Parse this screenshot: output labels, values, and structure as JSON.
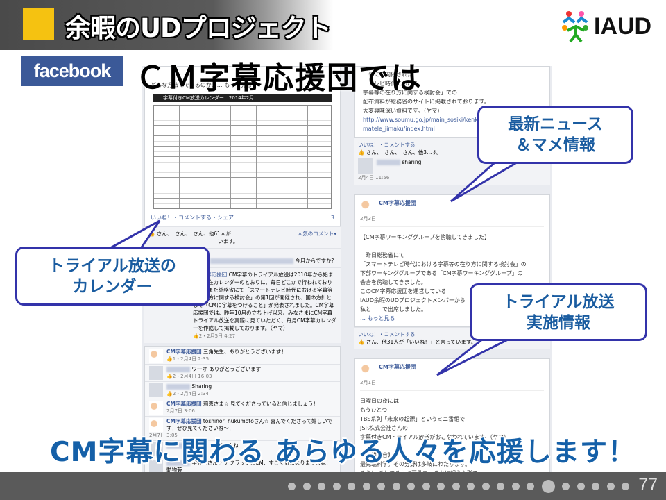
{
  "header": {
    "title": "余暇のUDプロジェクト",
    "logo_text": "IAUD"
  },
  "facebook_logo": "facebook",
  "subtitle": "ＣＭ字幕応援団では",
  "left_column": {
    "post_more": "どんな方法でできるのか、… もっと見る",
    "calendar_title": "字幕付きCM放送カレンダー　2014年2月",
    "actions": "いいね！・コメントする・シェア",
    "comment_count": "3",
    "likes": "さん、　さん、　さん、他61人が",
    "popular": "人気のコメント▾",
    "likes_tail": "います。",
    "comment_q": "今月からですか？",
    "reply_author": "CM字幕応援団",
    "reply_text": "CM字幕のトライアル放送は2010年から始まり、現在カレンダーのとおりに、毎日どこかで行われております。また総務省にて「スマートテレビ時代における字幕等の在り方に関する検討会」の第1回が開催され、国の方針として「CMに字幕をつけること」が発表されました。CM字幕応援団では、昨年10月の立ち上げ以来、みなさまにCM字幕トライアル放送を実際に見ていただく、毎月CM字幕カレンダーを作成して掲載しております。（ヤマ）",
    "reply_meta": "👍2・2月5日 4:27",
    "comments": [
      {
        "author": "CM字幕応援団",
        "text": "三角先生、ありがとうございます！",
        "meta": "👍1・2月4日 2:35",
        "page": true
      },
      {
        "author": "",
        "text": "ワーオ ありがとうございます",
        "meta": "👍2・2月4日 16:03",
        "page": false
      },
      {
        "author": "",
        "text": "Sharing",
        "meta": "👍2・2月4日 2:34",
        "page": false
      },
      {
        "author": "CM字幕応援団",
        "text": "莉恵さま☆ 見てくださっていると信じましょう！",
        "meta": "2月7日 3:06",
        "page": true
      },
      {
        "author": "CM字幕応援団",
        "text": "toshinori hukumotoさん☆ 喜んでくださって嬉しいです！ぜひ見てくださいね～！",
        "meta": "2月7日 3:05",
        "page": true
      },
      {
        "author": "",
        "text": "…ル見…こですよね",
        "meta": "",
        "page": false
      },
      {
        "author": "",
        "text": "宇佐川さん☆ アフラックのCM、すごく気になりますよね！動物兼",
        "meta": "",
        "page": false
      }
    ]
  },
  "right_column": {
    "post1_lines": [
      "…省にて開催された",
      "…テレビ時代における",
      "字幕等の在り方に関する検討会」での",
      "配布資料が総務省のサイトに掲載されております。",
      "大変興味深い資料です。（ヤマ）"
    ],
    "post1_link": "http://www.soumu.go.jp/main_sosiki/kenkyu/sumatele_jimaku/index.html",
    "post1_actions": "いいね！・コメントする",
    "post1_likes": "さん、　さん、　さん、他3…す。",
    "post1_share": "sharing",
    "post1_share_time": "2月4日 11:56",
    "post2_author": "CM字幕応援団",
    "post2_date": "2月3日",
    "post2_lines": [
      "【CM字幕ワーキンググループを傍聴してきました】",
      "",
      "　昨日総務省にて",
      "「スマートテレビ時代における字幕等の在り方に関する検討会」の",
      "下部ワーキンググループである「CM字幕ワーキンググループ」の",
      "会合を傍聴してきました。",
      "このCM字幕応援団を運営している",
      "IAUD余暇のUDプロジェクトメンバーから",
      "私と　　で出席しました。"
    ],
    "post2_more": "… もっと見る",
    "post2_actions": "いいね！・コメントする",
    "post2_likes": "さん、他31人が「いいね！」と言っています。",
    "post3_author": "CM字幕応援団",
    "post3_date": "2月1日",
    "post3_lines": [
      "日曜日の夜には",
      "もうひとつ",
      "TBS系列「未来の起源」というミニ番組で",
      "JSR株式会社さんの",
      "字幕付きCMトライアル放送がおこなわれています。（ヤマ）",
      "",
      "【番組内容】",
      "最先端科学。その分野は多岐にわたります。",
      "そう！ そしてそれに画像をはるかに超えた形で"
    ]
  },
  "callouts": {
    "news": [
      "最新ニュース",
      "＆マメ情報"
    ],
    "calendar": [
      "トライアル放送の",
      "カレンダー"
    ],
    "trial": [
      "トライアル放送",
      "実施情報"
    ]
  },
  "tagline": "CM字幕に関わる あらゆる人々を応援します！",
  "footer": {
    "page_number": "77",
    "dot_count": 23,
    "current_dot": 18
  },
  "colors": {
    "accent_yellow": "#f5c211",
    "facebook_blue": "#3b5998",
    "callout_border": "#3333aa",
    "text_blue": "#1560a8",
    "footer": "#5a5a5a"
  }
}
